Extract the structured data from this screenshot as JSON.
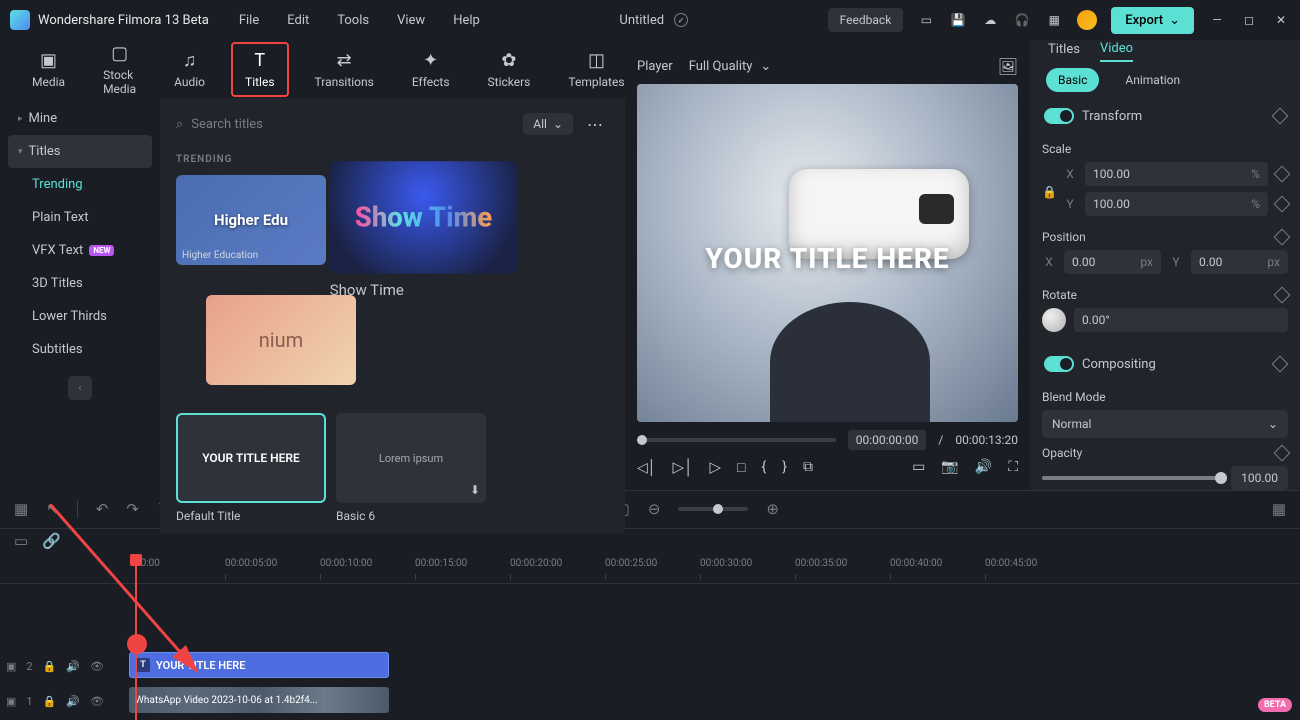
{
  "app": {
    "name": "Wondershare Filmora 13 Beta",
    "doc": "Untitled"
  },
  "menu": [
    "File",
    "Edit",
    "Tools",
    "View",
    "Help"
  ],
  "feedback": "Feedback",
  "export": "Export",
  "tabs": [
    {
      "label": "Media"
    },
    {
      "label": "Stock Media"
    },
    {
      "label": "Audio"
    },
    {
      "label": "Titles"
    },
    {
      "label": "Transitions"
    },
    {
      "label": "Effects"
    },
    {
      "label": "Stickers"
    },
    {
      "label": "Templates"
    }
  ],
  "sidebar": {
    "mine": "Mine",
    "titles": "Titles",
    "subs": [
      {
        "label": "Trending",
        "active": true
      },
      {
        "label": "Plain Text"
      },
      {
        "label": "VFX Text",
        "new": true
      },
      {
        "label": "3D Titles"
      },
      {
        "label": "Lower Thirds"
      },
      {
        "label": "Subtitles"
      }
    ]
  },
  "search": {
    "placeholder": "Search titles",
    "filter": "All"
  },
  "section": "TRENDING",
  "cards": {
    "edu_sub": "Higher Education",
    "show_label": "Show Time",
    "default_thumb": "YOUR TITLE HERE",
    "default_label": "Default Title",
    "basic_thumb": "Lorem ipsum",
    "basic_label": "Basic 6"
  },
  "player": {
    "label": "Player",
    "quality": "Full Quality",
    "preview_text": "YOUR TITLE HERE",
    "time_current": "00:00:00:00",
    "time_sep": "/",
    "time_total": "00:00:13:20"
  },
  "inspector": {
    "tabs": {
      "titles": "Titles",
      "video": "Video"
    },
    "sub": {
      "basic": "Basic",
      "animation": "Animation"
    },
    "transform": "Transform",
    "scale": "Scale",
    "scale_x": "100.00",
    "scale_y": "100.00",
    "pct": "%",
    "position": "Position",
    "pos_x": "0.00",
    "pos_y": "0.00",
    "px": "px",
    "rotate": "Rotate",
    "rotate_val": "0.00°",
    "compositing": "Compositing",
    "blend": "Blend Mode",
    "blend_val": "Normal",
    "opacity": "Opacity",
    "opacity_val": "100.00",
    "X": "X",
    "Y": "Y"
  },
  "ruler": [
    "00:00",
    "00:00:05:00",
    "00:00:10:00",
    "00:00:15:00",
    "00:00:20:00",
    "00:00:25:00",
    "00:00:30:00",
    "00:00:35:00",
    "00:00:40:00",
    "00:00:45:00"
  ],
  "clips": {
    "title": "YOUR TITLE HERE",
    "video": "WhatsApp Video 2023-10-06 at 1.4b2f4..."
  },
  "track_nums": {
    "t2": "2",
    "t1": "1"
  },
  "new_badge": "NEW",
  "beta": "BETA"
}
